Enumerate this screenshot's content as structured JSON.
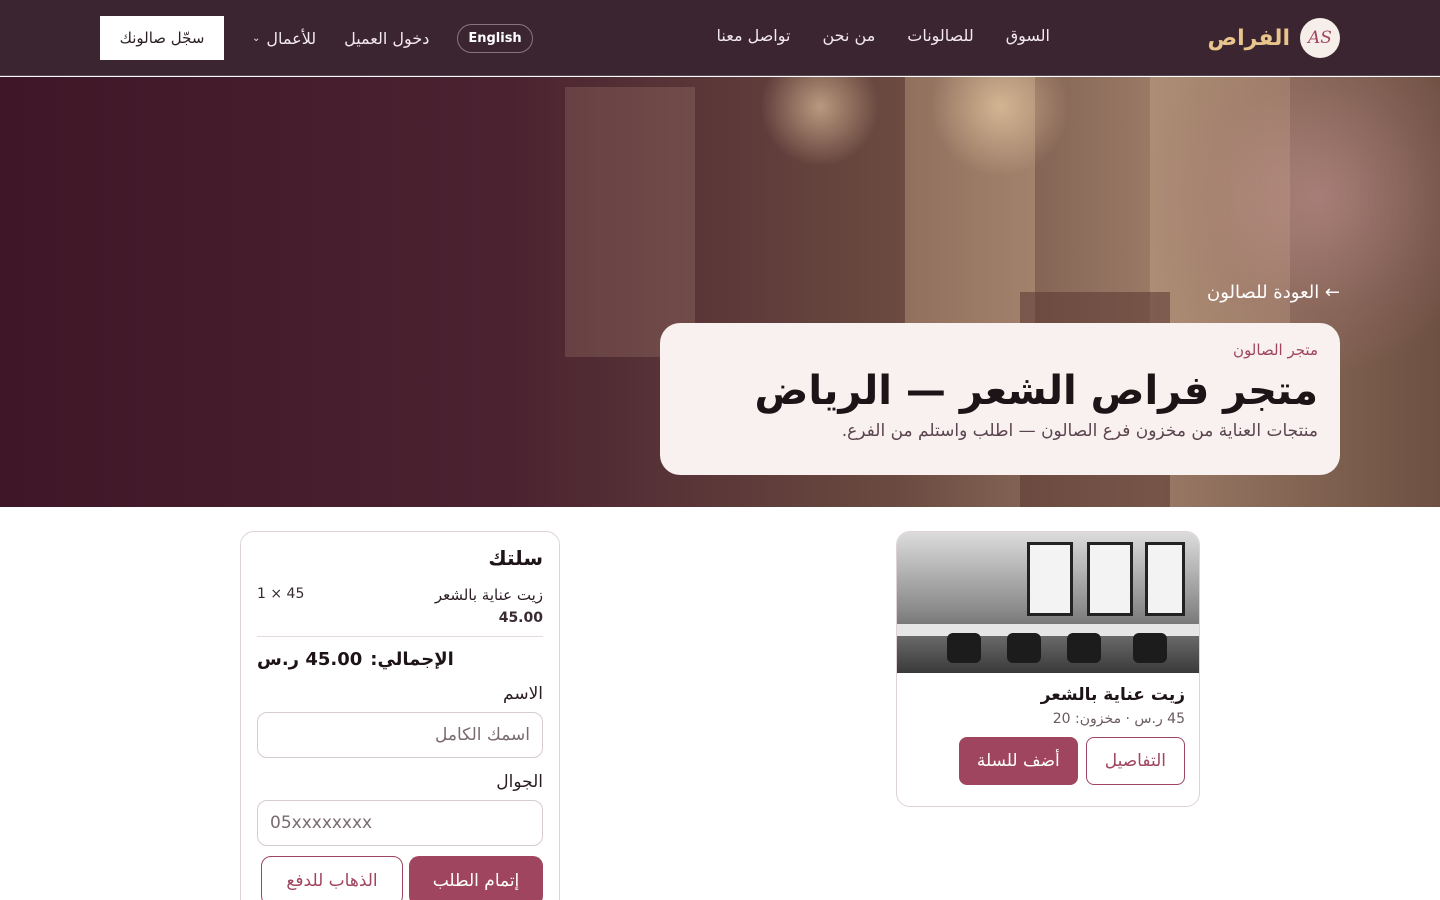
{
  "nav": {
    "brand_name": "الفراص",
    "logo_text": "AS",
    "links": [
      "السوق",
      "للصالونات",
      "من نحن",
      "تواصل معنا"
    ],
    "language_button": "English",
    "client_login": "دخول العميل",
    "business_menu": "للأعمال",
    "register_button": "سجّل صالونك"
  },
  "hero": {
    "back_link": "← العودة للصالون",
    "eyebrow": "متجر الصالون",
    "title": "متجر فراص الشعر — الرياض",
    "subtitle": "منتجات العناية من مخزون فرع الصالون — اطلب واستلم من الفرع."
  },
  "product": {
    "name": "زيت عناية بالشعر",
    "meta": "45 ر.س · مخزون: 20",
    "details_button": "التفاصيل",
    "add_to_cart_button": "أضف للسلة"
  },
  "cart": {
    "title": "سلتك",
    "items": [
      {
        "name": "زيت عناية بالشعر",
        "qty_line": "1 × 45",
        "line_total": "45.00"
      }
    ],
    "total_label": "الإجمالي:",
    "total_value": "45.00 ر.س",
    "name_label": "الاسم",
    "name_placeholder": "اسمك الكامل",
    "phone_label": "الجوال",
    "phone_placeholder": "05xxxxxxxx",
    "checkout_button": "إتمام الطلب",
    "pay_button": "الذهاب للدفع"
  },
  "colors": {
    "nav_bg": "#3b2530",
    "accent": "#a0455f",
    "brand_gold": "#e8c58c"
  }
}
